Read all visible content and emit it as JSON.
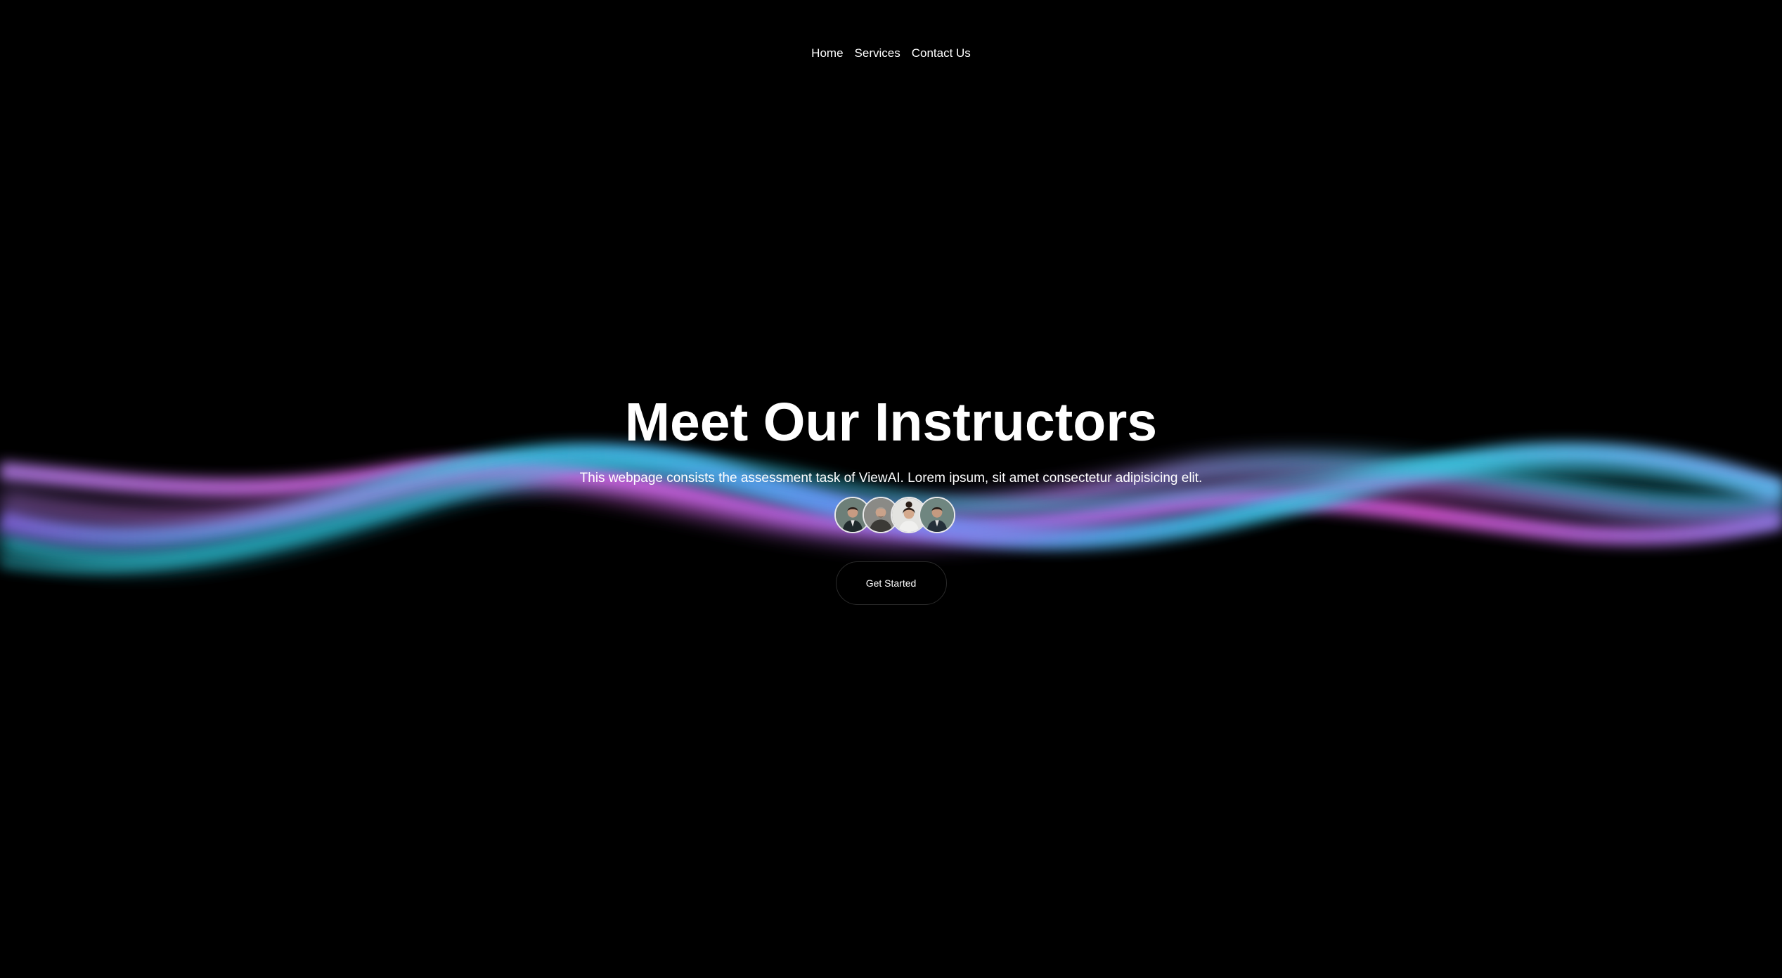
{
  "nav": {
    "items": [
      {
        "label": "Home"
      },
      {
        "label": "Services"
      },
      {
        "label": "Contact Us"
      }
    ]
  },
  "hero": {
    "title": "Meet Our Instructors",
    "subtitle": "This webpage consists the assessment task of ViewAI. Lorem ipsum, sit amet consectetur adipisicing elit.",
    "cta_label": "Get Started",
    "avatar_count": 4
  },
  "colors": {
    "background": "#000000",
    "text": "#ffffff",
    "wave_cyan": "#2ec4d6",
    "wave_purple": "#b47be8",
    "wave_pink": "#e05adf",
    "wave_blue": "#6a8ef5"
  }
}
